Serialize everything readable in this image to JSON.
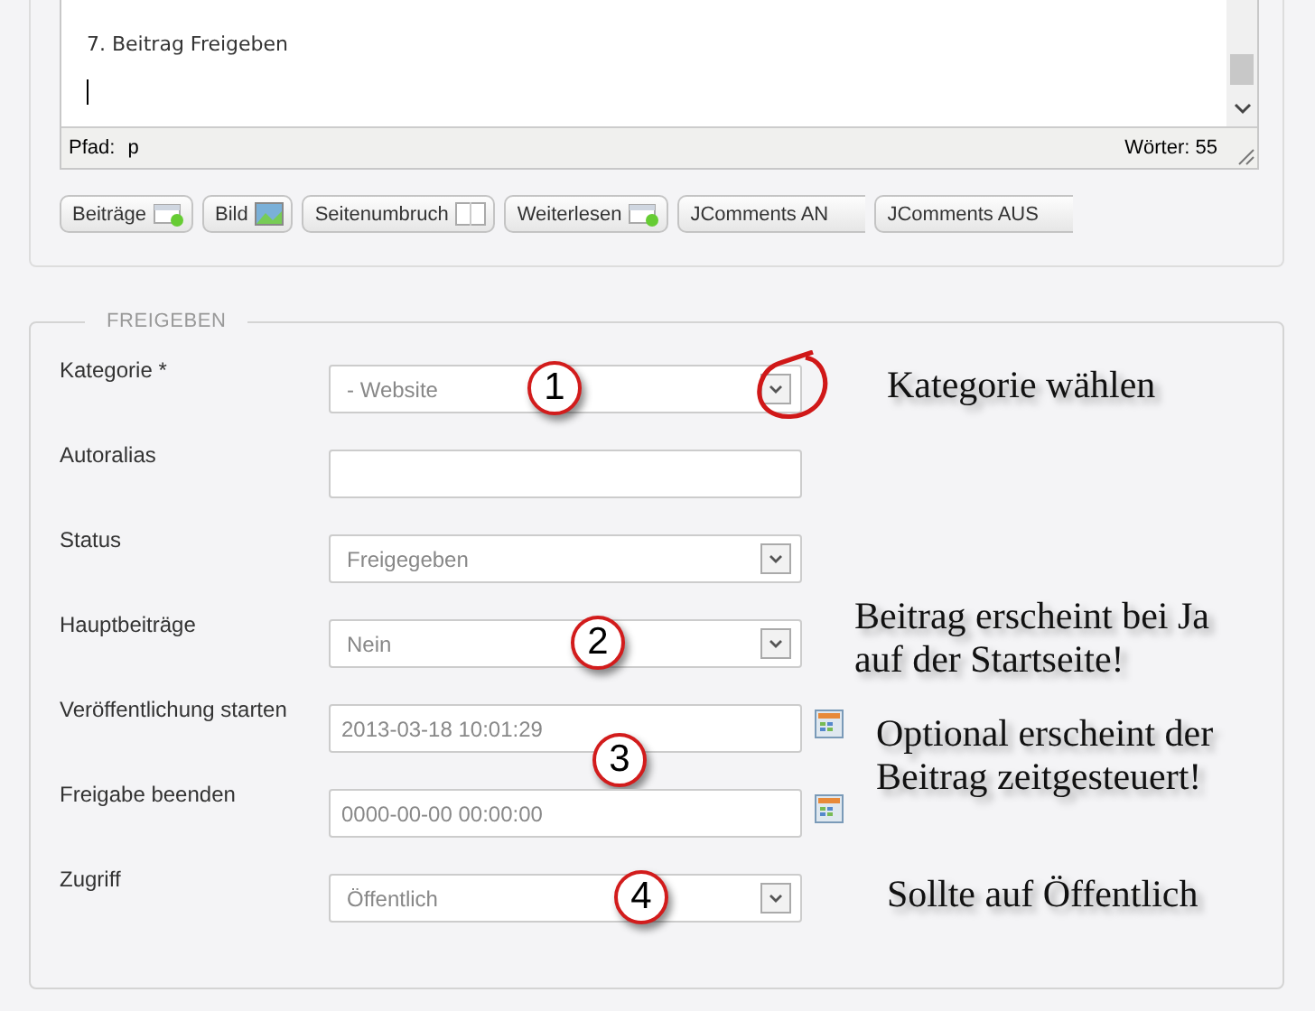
{
  "editor": {
    "text": "7. Beitrag Freigeben",
    "path_label": "Pfad:",
    "path": "p",
    "word_count": "Wörter: 55"
  },
  "buttons": [
    {
      "label": "Beiträge",
      "kind": "article"
    },
    {
      "label": "Bild",
      "kind": "image"
    },
    {
      "label": "Seitenumbruch",
      "kind": "pagebreak"
    },
    {
      "label": "Weiterlesen",
      "kind": "article"
    },
    {
      "label": "JComments AN",
      "kind": "plain"
    },
    {
      "label": "JComments AUS",
      "kind": "plain"
    }
  ],
  "fieldset": {
    "legend": "FREIGEBEN",
    "fields": [
      {
        "label": "Kategorie *",
        "kind": "select",
        "value": "- Website",
        "marker": "1",
        "highlighted": true,
        "note": [
          "Kategorie wählen"
        ]
      },
      {
        "label": "Autoralias",
        "kind": "text",
        "highlighted": false
      },
      {
        "label": "Status",
        "kind": "select",
        "value": "Freigegeben",
        "highlighted": false
      },
      {
        "label": "Hauptbeiträge",
        "kind": "select",
        "value": "Nein",
        "marker": "2",
        "highlighted": false,
        "note": [
          "Beitrag erscheint bei Ja",
          "auf der Startseite!"
        ]
      },
      {
        "label": "Veröffentlichung starten",
        "kind": "date",
        "value": "2013-03-18 10:01:29",
        "marker": "3",
        "highlighted": false,
        "note": [
          "Optional erscheint der",
          "Beitrag zeitgesteuert!"
        ]
      },
      {
        "label": "Freigabe beenden",
        "kind": "date",
        "value": "0000-00-00 00:00:00",
        "highlighted": false
      },
      {
        "label": "Zugriff",
        "kind": "select",
        "value": "Öffentlich",
        "marker": "4",
        "highlighted": false,
        "note": [
          "Sollte auf Öffentlich"
        ]
      }
    ]
  }
}
